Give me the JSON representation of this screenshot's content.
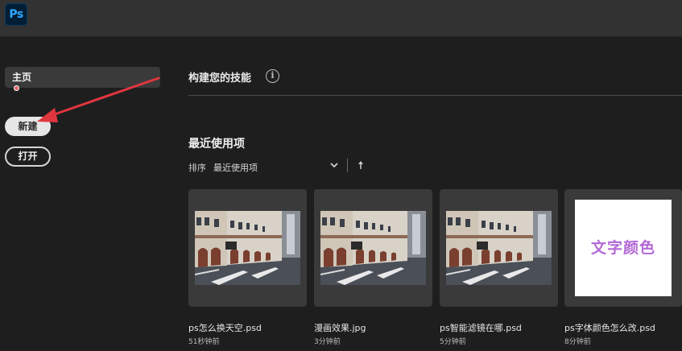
{
  "app": {
    "logo_text": "Ps"
  },
  "sidebar": {
    "home_label": "主页",
    "new_label": "新建",
    "open_label": "打开"
  },
  "skills": {
    "title": "构建您的技能",
    "info_glyph": "i"
  },
  "recent": {
    "title": "最近使用项",
    "sort_label": "排序",
    "sort_value": "最近使用项",
    "files": [
      {
        "name": "ps怎么换天空.psd",
        "time": "51秒钟前"
      },
      {
        "name": "漫画效果.jpg",
        "time": "3分钟前"
      },
      {
        "name": "ps智能滤镜在哪.psd",
        "time": "5分钟前"
      },
      {
        "name": "ps字体颜色怎么改.psd",
        "time": "8分钟前",
        "thumb_text": "文字颜色"
      }
    ]
  },
  "colors": {
    "ps_logo_text": "#31a8ff",
    "ps_logo_bg": "#001e36",
    "annotation_arrow": "#e0363f",
    "thumb_text": "#b36ad6"
  }
}
